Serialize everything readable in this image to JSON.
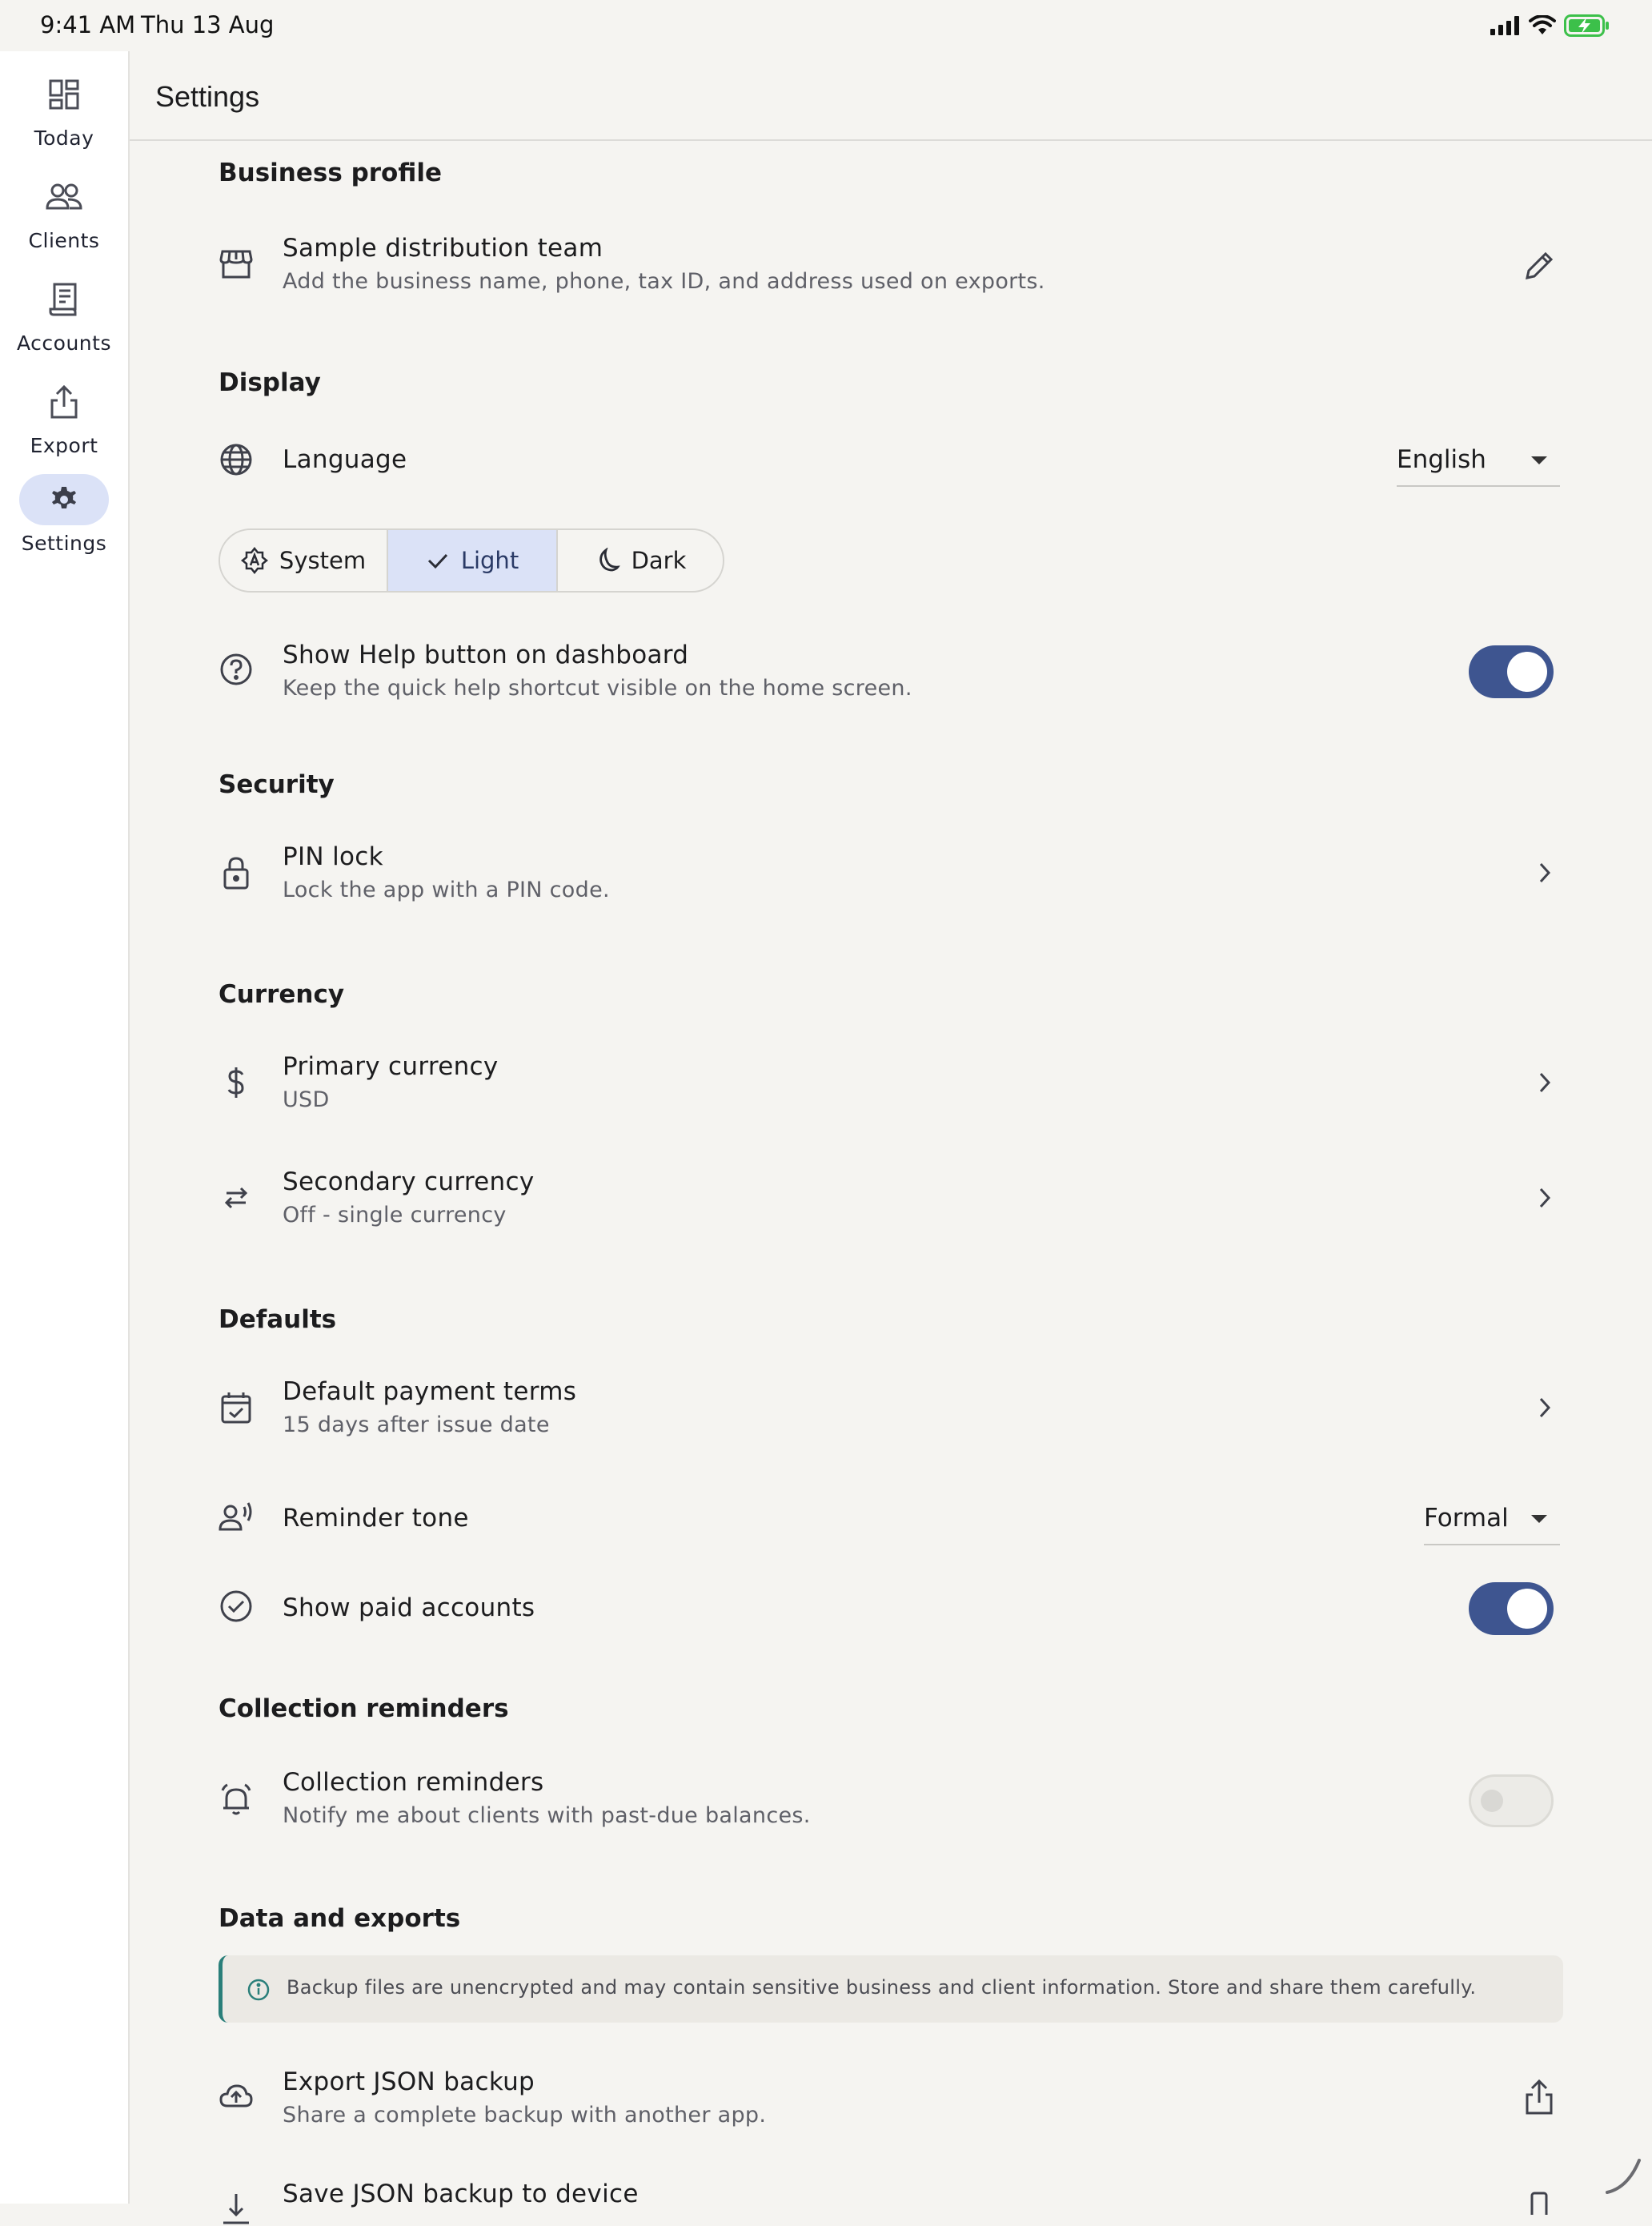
{
  "status": {
    "time": "9:41 AM",
    "date": "Thu 13 Aug"
  },
  "rail": {
    "items": [
      {
        "label": "Today",
        "icon": "dashboard-icon"
      },
      {
        "label": "Clients",
        "icon": "people-icon"
      },
      {
        "label": "Accounts",
        "icon": "receipt-icon"
      },
      {
        "label": "Export",
        "icon": "share-icon"
      },
      {
        "label": "Settings",
        "icon": "gear-icon",
        "active": true
      }
    ]
  },
  "header": {
    "title": "Settings"
  },
  "sections": {
    "business": {
      "title": "Business profile",
      "profile": {
        "primary": "Sample distribution team",
        "secondary": "Add the business name, phone, tax ID, and address used on exports."
      }
    },
    "display": {
      "title": "Display",
      "language": {
        "label": "Language",
        "value": "English"
      },
      "theme": {
        "options": [
          "System",
          "Light",
          "Dark"
        ],
        "selected": "Light"
      },
      "help": {
        "primary": "Show Help button on dashboard",
        "secondary": "Keep the quick help shortcut visible on the home screen.",
        "enabled": true
      }
    },
    "security": {
      "title": "Security",
      "pin": {
        "primary": "PIN lock",
        "secondary": "Lock the app with a PIN code."
      }
    },
    "currency": {
      "title": "Currency",
      "primary": {
        "primary": "Primary currency",
        "secondary": "USD"
      },
      "secondary": {
        "primary": "Secondary currency",
        "secondary": "Off - single currency"
      }
    },
    "defaults": {
      "title": "Defaults",
      "terms": {
        "primary": "Default payment terms",
        "secondary": "15 days after issue date"
      },
      "tone": {
        "label": "Reminder tone",
        "value": "Formal"
      },
      "paid": {
        "label": "Show paid accounts",
        "enabled": true
      }
    },
    "reminders": {
      "title": "Collection reminders",
      "item": {
        "primary": "Collection reminders",
        "secondary": "Notify me about clients with past-due balances.",
        "enabled": false
      }
    },
    "data": {
      "title": "Data and exports",
      "banner": "Backup files are unencrypted and may contain sensitive business and client information. Store and share them carefully.",
      "export": {
        "primary": "Export JSON backup",
        "secondary": "Share a complete backup with another app."
      },
      "save": {
        "primary": "Save JSON backup to device"
      }
    }
  },
  "colors": {
    "accent": "#3e5590",
    "selected_bg": "#dbe2f7",
    "info": "#2a7f7a",
    "battery": "#3cc04a"
  }
}
